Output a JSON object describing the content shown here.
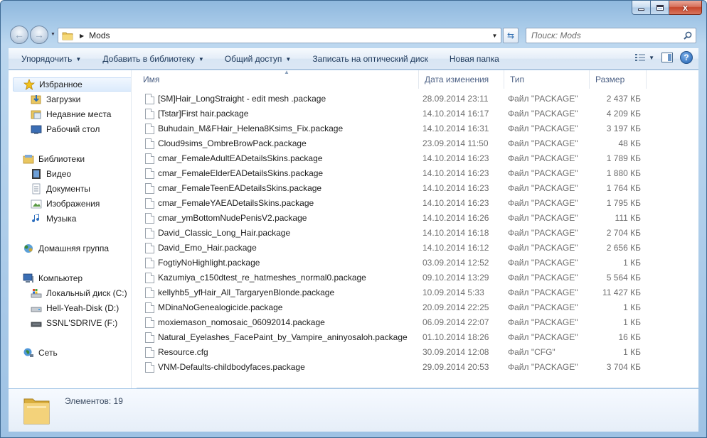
{
  "window": {
    "close_glyph": "x"
  },
  "address": {
    "path": "Mods",
    "search_placeholder": "Поиск: Mods"
  },
  "toolbar": {
    "organize": "Упорядочить",
    "add_library": "Добавить в библиотеку",
    "share": "Общий доступ",
    "burn": "Записать на оптический диск",
    "new_folder": "Новая папка"
  },
  "sidebar": {
    "favorites": "Избранное",
    "downloads": "Загрузки",
    "recent": "Недавние места",
    "desktop": "Рабочий стол",
    "libraries": "Библиотеки",
    "video": "Видео",
    "documents": "Документы",
    "images": "Изображения",
    "music": "Музыка",
    "homegroup": "Домашняя группа",
    "computer": "Компьютер",
    "drive_c": "Локальный диск (C:)",
    "drive_d": "Hell-Yeah-Disk (D:)",
    "drive_f": "SSNL'SDRIVE (F:)",
    "network": "Сеть"
  },
  "columns": {
    "name": "Имя",
    "date": "Дата изменения",
    "type": "Тип",
    "size": "Размер"
  },
  "files": [
    {
      "name": "[SM]Hair_LongStraight - edit mesh .package",
      "date": "28.09.2014 23:11",
      "type": "Файл \"PACKAGE\"",
      "size": "2 437 КБ"
    },
    {
      "name": "[Tstar]First hair.package",
      "date": "14.10.2014 16:17",
      "type": "Файл \"PACKAGE\"",
      "size": "4 209 КБ"
    },
    {
      "name": "Buhudain_M&FHair_Helena8Ksims_Fix.package",
      "date": "14.10.2014 16:31",
      "type": "Файл \"PACKAGE\"",
      "size": "3 197 КБ"
    },
    {
      "name": "Cloud9sims_OmbreBrowPack.package",
      "date": "23.09.2014 11:50",
      "type": "Файл \"PACKAGE\"",
      "size": "48 КБ"
    },
    {
      "name": "cmar_FemaleAdultEADetailsSkins.package",
      "date": "14.10.2014 16:23",
      "type": "Файл \"PACKAGE\"",
      "size": "1 789 КБ"
    },
    {
      "name": "cmar_FemaleElderEADetailsSkins.package",
      "date": "14.10.2014 16:23",
      "type": "Файл \"PACKAGE\"",
      "size": "1 880 КБ"
    },
    {
      "name": "cmar_FemaleTeenEADetailsSkins.package",
      "date": "14.10.2014 16:23",
      "type": "Файл \"PACKAGE\"",
      "size": "1 764 КБ"
    },
    {
      "name": "cmar_FemaleYAEADetailsSkins.package",
      "date": "14.10.2014 16:23",
      "type": "Файл \"PACKAGE\"",
      "size": "1 795 КБ"
    },
    {
      "name": "cmar_ymBottomNudePenisV2.package",
      "date": "14.10.2014 16:26",
      "type": "Файл \"PACKAGE\"",
      "size": "111 КБ"
    },
    {
      "name": "David_Classic_Long_Hair.package",
      "date": "14.10.2014 16:18",
      "type": "Файл \"PACKAGE\"",
      "size": "2 704 КБ"
    },
    {
      "name": "David_Emo_Hair.package",
      "date": "14.10.2014 16:12",
      "type": "Файл \"PACKAGE\"",
      "size": "2 656 КБ"
    },
    {
      "name": "FogtiyNoHighlight.package",
      "date": "03.09.2014 12:52",
      "type": "Файл \"PACKAGE\"",
      "size": "1 КБ"
    },
    {
      "name": "Kazumiya_c150dtest_re_hatmeshes_normal0.package",
      "date": "09.10.2014 13:29",
      "type": "Файл \"PACKAGE\"",
      "size": "5 564 КБ"
    },
    {
      "name": "kellyhb5_yfHair_All_TargaryenBlonde.package",
      "date": "10.09.2014 5:33",
      "type": "Файл \"PACKAGE\"",
      "size": "11 427 КБ"
    },
    {
      "name": "MDinaNoGenealogicide.package",
      "date": "20.09.2014 22:25",
      "type": "Файл \"PACKAGE\"",
      "size": "1 КБ"
    },
    {
      "name": "moxiemason_nomosaic_06092014.package",
      "date": "06.09.2014 22:07",
      "type": "Файл \"PACKAGE\"",
      "size": "1 КБ"
    },
    {
      "name": "Natural_Eyelashes_FacePaint_by_Vampire_aninyosaloh.package",
      "date": "01.10.2014 18:26",
      "type": "Файл \"PACKAGE\"",
      "size": "16 КБ"
    },
    {
      "name": "Resource.cfg",
      "date": "30.09.2014 12:08",
      "type": "Файл \"CFG\"",
      "size": "1 КБ"
    },
    {
      "name": "VNM-Defaults-childbodyfaces.package",
      "date": "29.09.2014 20:53",
      "type": "Файл \"PACKAGE\"",
      "size": "3 704 КБ"
    }
  ],
  "details": {
    "count_text": "Элементов: 19"
  }
}
